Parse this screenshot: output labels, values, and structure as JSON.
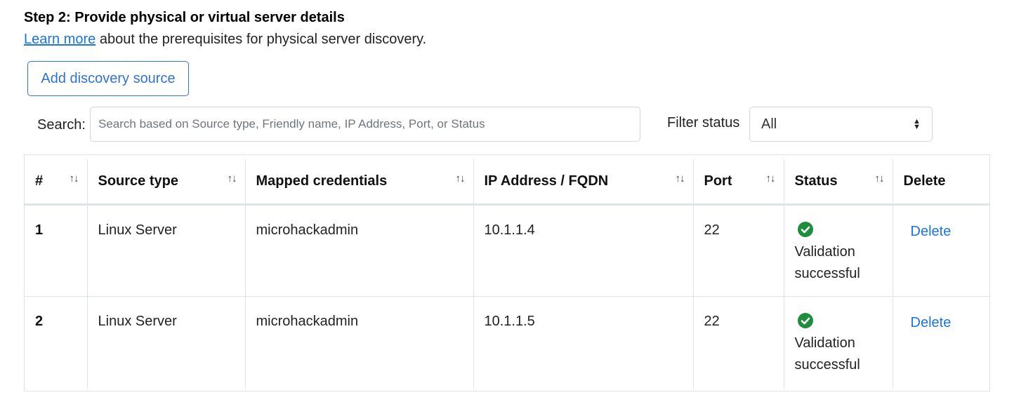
{
  "step": {
    "title": "Step 2: Provide physical or virtual server details",
    "learn_more_link": "Learn more",
    "learn_more_rest": " about the prerequisites for physical server discovery."
  },
  "toolbar": {
    "add_source_label": "Add discovery source"
  },
  "search": {
    "label": "Search:",
    "placeholder": "Search based on Source type, Friendly name, IP Address, Port, or Status",
    "value": ""
  },
  "filter": {
    "label": "Filter status",
    "selected": "All"
  },
  "table": {
    "columns": [
      "#",
      "Source type",
      "Mapped credentials",
      "IP Address / FQDN",
      "Port",
      "Status",
      "Delete"
    ],
    "rows": [
      {
        "num": "1",
        "source_type": "Linux Server",
        "credentials": "microhackadmin",
        "ip": "10.1.1.4",
        "port": "22",
        "status_icon": "check-circle-icon",
        "status_line1": "Validation",
        "status_line2": "successful",
        "delete_label": "Delete"
      },
      {
        "num": "2",
        "source_type": "Linux Server",
        "credentials": "microhackadmin",
        "ip": "10.1.1.5",
        "port": "22",
        "status_icon": "check-circle-icon",
        "status_line1": "Validation",
        "status_line2": "successful",
        "delete_label": "Delete"
      }
    ]
  },
  "colors": {
    "link": "#1a73e8",
    "button_border": "#2f73d8",
    "success": "#1e8e3e",
    "border": "#dde3e6"
  }
}
